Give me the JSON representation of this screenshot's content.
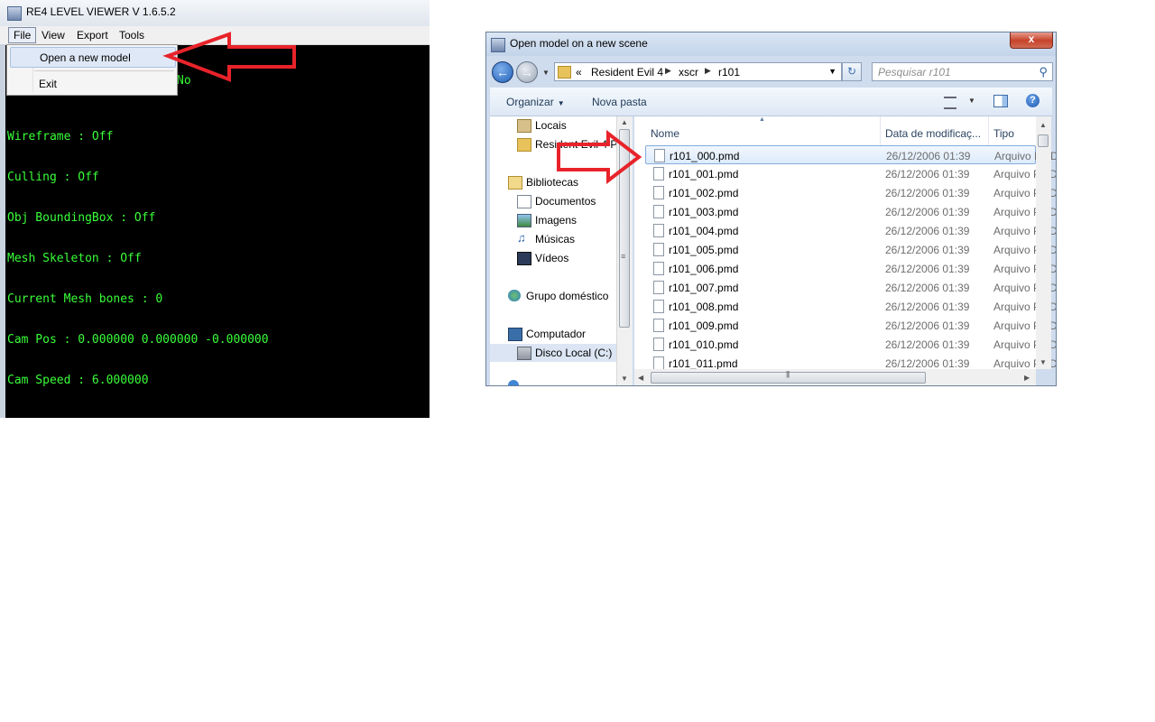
{
  "viewer": {
    "title": "RE4 LEVEL VIEWER V 1.6.5.2",
    "menu": [
      "File",
      "View",
      "Export",
      "Tools"
    ],
    "console_lines": [
      "Wireframe : Off",
      "Culling : Off",
      "Obj BoundingBox : Off",
      "Mesh Skeleton : Off",
      "Current Mesh bones : 0",
      "Cam Pos : 0.000000 0.000000 -0.000000",
      "Cam Speed : 6.000000"
    ],
    "partial_text": "No",
    "file_menu": {
      "open_model": "Open a new model",
      "exit": "Exit"
    }
  },
  "dialog": {
    "title": "Open model on a new scene",
    "close_glyph": "x",
    "address": {
      "overflow": "«",
      "crumbs": [
        "Resident Evil 4",
        "xscr",
        "r101"
      ]
    },
    "search_placeholder": "Pesquisar r101",
    "toolbar": {
      "organize": "Organizar",
      "new_folder": "Nova pasta",
      "help": "?"
    },
    "nav": {
      "locais": "Locais",
      "re4": "Resident Evil 4 PC",
      "bibliotecas": "Bibliotecas",
      "documentos": "Documentos",
      "imagens": "Imagens",
      "musicas": "Músicas",
      "videos": "Vídeos",
      "grupo": "Grupo doméstico",
      "computador": "Computador",
      "disco": "Disco Local (C:)"
    },
    "columns": {
      "name": "Nome",
      "date": "Data de modificaç...",
      "type": "Tipo"
    },
    "files": [
      {
        "name": "r101_000.pmd",
        "date": "26/12/2006 01:39",
        "type": "Arquivo PMD"
      },
      {
        "name": "r101_001.pmd",
        "date": "26/12/2006 01:39",
        "type": "Arquivo PMD"
      },
      {
        "name": "r101_002.pmd",
        "date": "26/12/2006 01:39",
        "type": "Arquivo PMD"
      },
      {
        "name": "r101_003.pmd",
        "date": "26/12/2006 01:39",
        "type": "Arquivo PMD"
      },
      {
        "name": "r101_004.pmd",
        "date": "26/12/2006 01:39",
        "type": "Arquivo PMD"
      },
      {
        "name": "r101_005.pmd",
        "date": "26/12/2006 01:39",
        "type": "Arquivo PMD"
      },
      {
        "name": "r101_006.pmd",
        "date": "26/12/2006 01:39",
        "type": "Arquivo PMD"
      },
      {
        "name": "r101_007.pmd",
        "date": "26/12/2006 01:39",
        "type": "Arquivo PMD"
      },
      {
        "name": "r101_008.pmd",
        "date": "26/12/2006 01:39",
        "type": "Arquivo PMD"
      },
      {
        "name": "r101_009.pmd",
        "date": "26/12/2006 01:39",
        "type": "Arquivo PMD"
      },
      {
        "name": "r101_010.pmd",
        "date": "26/12/2006 01:39",
        "type": "Arquivo PMD"
      },
      {
        "name": "r101_011.pmd",
        "date": "26/12/2006 01:39",
        "type": "Arquivo PMD"
      }
    ]
  },
  "colors": {
    "console_text": "#39ff39",
    "annotation_arrow": "#e8232a"
  }
}
